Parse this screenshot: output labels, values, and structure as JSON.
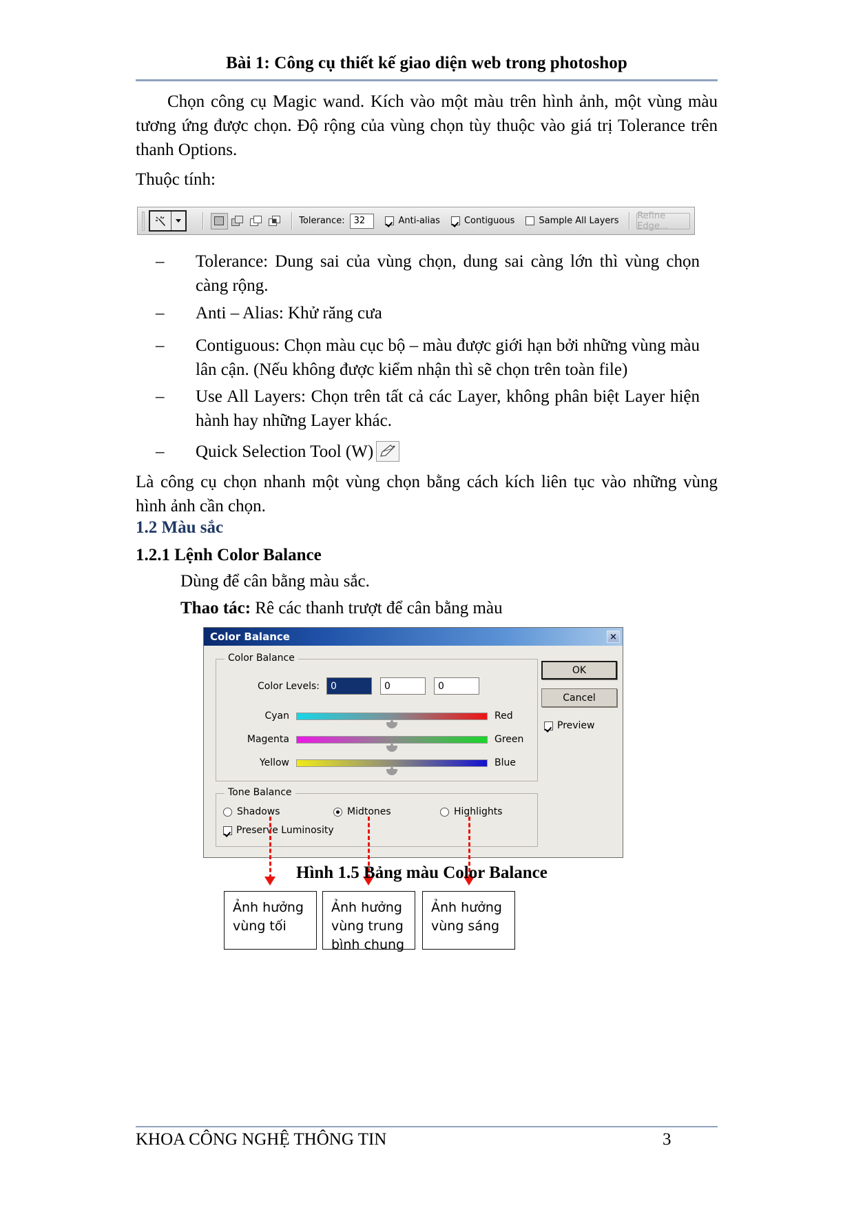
{
  "header": {
    "title": "Bài 1: Công cụ thiết kế giao diện web trong photoshop"
  },
  "body": {
    "para1": "Chọn công cụ Magic wand. Kích vào một màu trên hình ảnh, một vùng màu tương ứng được chọn. Độ rộng của vùng chọn tùy thuộc vào giá trị Tolerance trên thanh Options.",
    "para2": "Thuộc tính:",
    "para3": "Là công cụ chọn nhanh một vùng chọn bằng cách kích liên tục vào những vùng hình ảnh cần chọn."
  },
  "options_bar": {
    "tool_icon": "magic-wand-icon",
    "tolerance_label": "Tolerance:",
    "tolerance_value": "32",
    "anti_alias_label": "Anti-alias",
    "anti_alias_checked": true,
    "contiguous_label": "Contiguous",
    "contiguous_checked": true,
    "sample_all_layers_label": "Sample All Layers",
    "sample_all_layers_checked": false,
    "refine_edge_label": "Refine Edge...",
    "refine_edge_disabled": true
  },
  "bullets": [
    {
      "dash": "–",
      "text": "Tolerance: Dung sai của vùng chọn, dung sai càng lớn thì vùng chọn càng rộng."
    },
    {
      "dash": "–",
      "text": "Anti – Alias: Khử răng cưa"
    },
    {
      "dash": "–",
      "text": "Contiguous: Chọn màu cục bộ – màu được giới hạn bởi những vùng màu lân cận. (Nếu không được kiểm nhận thì sẽ chọn trên toàn file)"
    },
    {
      "dash": "–",
      "text": "Use All Layers: Chọn trên tất cả các Layer, không phân biệt Layer hiện hành hay những Layer khác."
    },
    {
      "dash": "–",
      "text": "Quick Selection Tool (W)"
    }
  ],
  "sections": {
    "h_1_2": "1.2 Màu sắc",
    "h_1_2_1": "1.2.1 Lệnh Color Balance",
    "desc": "Dùng để cân bằng màu sắc.",
    "thao_tac_bold": "Thao tác:",
    "thao_tac_rest": " Rê các thanh trượt để cân bằng màu"
  },
  "dialog": {
    "title": "Color Balance",
    "close_label": "×",
    "group_color_balance": "Color Balance",
    "color_levels_label": "Color Levels:",
    "color_levels": [
      "0",
      "0",
      "0"
    ],
    "sliders": [
      {
        "left": "Cyan",
        "right": "Red",
        "value": 0,
        "from": "#18d6e6",
        "to": "#ef1414"
      },
      {
        "left": "Magenta",
        "right": "Green",
        "value": 0,
        "from": "#ec17e6",
        "to": "#1ad52a"
      },
      {
        "left": "Yellow",
        "right": "Blue",
        "value": 0,
        "from": "#f0ea18",
        "to": "#1312cf"
      }
    ],
    "group_tone_balance": "Tone Balance",
    "tone_options": [
      {
        "label": "Shadows",
        "selected": false
      },
      {
        "label": "Midtones",
        "selected": true
      },
      {
        "label": "Highlights",
        "selected": false
      }
    ],
    "preserve_luminosity_label": "Preserve Luminosity",
    "preserve_luminosity_checked": true,
    "ok_label": "OK",
    "cancel_label": "Cancel",
    "preview_label": "Preview",
    "preview_checked": true
  },
  "figure_caption": "Hình  1.5 Bảng màu Color Balance",
  "callouts": [
    {
      "line1": "Ảnh hưởng",
      "line2": "vùng tối",
      "line3": ""
    },
    {
      "line1": "Ảnh hưởng",
      "line2": "vùng  trung",
      "line3": "bình chung"
    },
    {
      "line1": "Ảnh hưởng",
      "line2": "vùng sáng",
      "line3": ""
    }
  ],
  "footer": {
    "left": "KHOA CÔNG NGHỆ THÔNG TIN",
    "page": "3"
  },
  "colors": {
    "rule": "#8fa2bd",
    "heading_blue": "#1f3864",
    "arrow_red": "#e8140c",
    "titlebar_blue": "#1f52a8"
  }
}
